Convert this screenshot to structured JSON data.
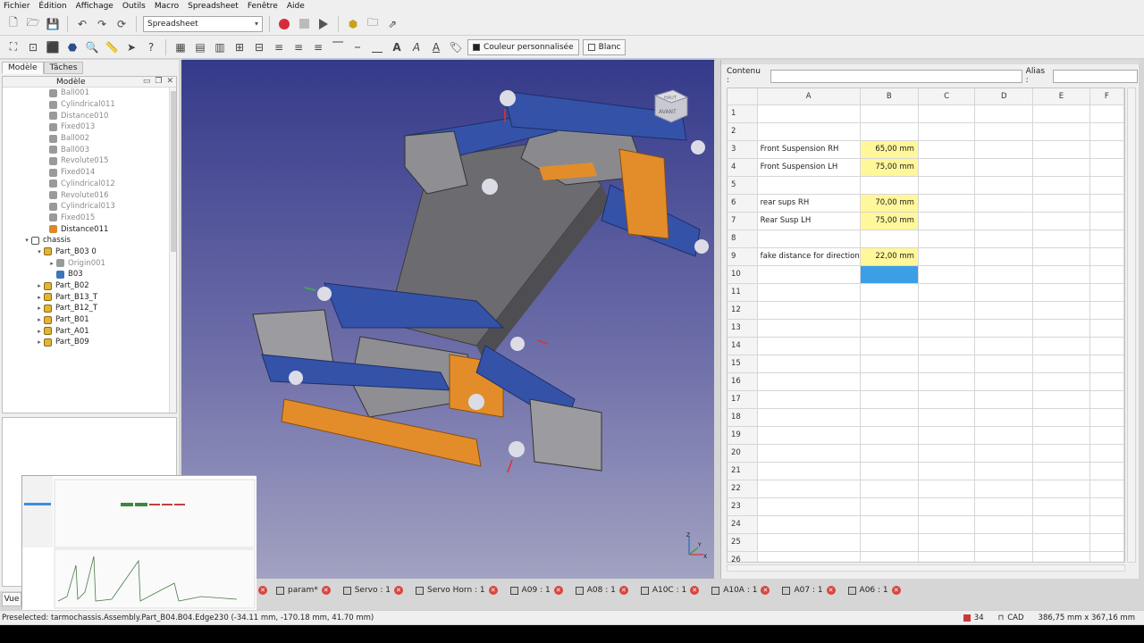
{
  "menu": [
    "Fichier",
    "Édition",
    "Affichage",
    "Outils",
    "Macro",
    "Spreadsheet",
    "Fenêtre",
    "Aide"
  ],
  "toolbar": {
    "workbench": "Spreadsheet",
    "custom_color_label": "Couleur personnalisée",
    "blank_label": "Blanc"
  },
  "left_panel": {
    "tabs": [
      "Modèle",
      "Tâches"
    ],
    "tree_header": "Modèle",
    "tree": [
      {
        "label": "Ball001",
        "dim": true
      },
      {
        "label": "Cylindrical011",
        "dim": true
      },
      {
        "label": "Distance010",
        "dim": true
      },
      {
        "label": "Fixed013",
        "dim": true
      },
      {
        "label": "Ball002",
        "dim": true
      },
      {
        "label": "Ball003",
        "dim": true
      },
      {
        "label": "Revolute015",
        "dim": true
      },
      {
        "label": "Fixed014",
        "dim": true
      },
      {
        "label": "Cylindrical012",
        "dim": true
      },
      {
        "label": "Revolute016",
        "dim": true
      },
      {
        "label": "Cylindrical013",
        "dim": true
      },
      {
        "label": "Fixed015",
        "dim": true
      },
      {
        "label": "Distance011",
        "dim": false
      },
      {
        "label": "chassis",
        "dim": false
      },
      {
        "label": "Part_B03 0",
        "dim": false
      },
      {
        "label": "Origin001",
        "dim": true
      },
      {
        "label": "B03",
        "dim": false
      },
      {
        "label": "Part_B02",
        "dim": false
      },
      {
        "label": "Part_B13_T",
        "dim": false
      },
      {
        "label": "Part_B12_T",
        "dim": false
      },
      {
        "label": "Part_B01",
        "dim": false
      },
      {
        "label": "Part_A01",
        "dim": false
      },
      {
        "label": "Part_B09",
        "dim": false
      }
    ],
    "vue_tab": "Vue"
  },
  "view3d": {
    "navcube_face": "AVANT",
    "navcube_top": "HAUT",
    "axes": [
      "X",
      "Y",
      "Z"
    ]
  },
  "sheet": {
    "contenu_label": "Contenu :",
    "alias_label": "Alias :",
    "columns": [
      "A",
      "B",
      "C",
      "D",
      "E",
      "F"
    ],
    "rows": [
      {
        "n": "1",
        "a": "",
        "b": ""
      },
      {
        "n": "2",
        "a": "",
        "b": ""
      },
      {
        "n": "3",
        "a": "Front Suspension RH",
        "b": "65,00 mm"
      },
      {
        "n": "4",
        "a": "Front Suspension LH",
        "b": "75,00 mm"
      },
      {
        "n": "5",
        "a": "",
        "b": ""
      },
      {
        "n": "6",
        "a": "rear sups RH",
        "b": "70,00 mm"
      },
      {
        "n": "7",
        "a": "Rear Susp LH",
        "b": "75,00 mm"
      },
      {
        "n": "8",
        "a": "",
        "b": ""
      },
      {
        "n": "9",
        "a": "fake distance for direction",
        "b": "22,00 mm"
      },
      {
        "n": "10",
        "a": "",
        "b": "",
        "selected": true
      },
      {
        "n": "11",
        "a": "",
        "b": ""
      },
      {
        "n": "12",
        "a": "",
        "b": ""
      },
      {
        "n": "13",
        "a": "",
        "b": ""
      },
      {
        "n": "14",
        "a": "",
        "b": ""
      },
      {
        "n": "15",
        "a": "",
        "b": ""
      },
      {
        "n": "16",
        "a": "",
        "b": ""
      },
      {
        "n": "17",
        "a": "",
        "b": ""
      },
      {
        "n": "18",
        "a": "",
        "b": ""
      },
      {
        "n": "19",
        "a": "",
        "b": ""
      },
      {
        "n": "20",
        "a": "",
        "b": ""
      },
      {
        "n": "21",
        "a": "",
        "b": ""
      },
      {
        "n": "22",
        "a": "",
        "b": ""
      },
      {
        "n": "23",
        "a": "",
        "b": ""
      },
      {
        "n": "24",
        "a": "",
        "b": ""
      },
      {
        "n": "25",
        "a": "",
        "b": ""
      },
      {
        "n": "26",
        "a": "",
        "b": ""
      }
    ]
  },
  "doc_tabs": [
    "param*",
    "Servo : 1",
    "Servo Horn : 1",
    "A09 : 1",
    "A08 : 1",
    "A10C : 1",
    "A10A : 1",
    "A07 : 1",
    "A06 : 1"
  ],
  "status": {
    "preselected": "Preselected: tarmochassis.Assembly.Part_B04.B04.Edge230 (-34.11 mm, -170.18 mm, 41.70 mm)",
    "count": "34",
    "nav_style": "CAD",
    "dimensions": "386,75 mm x 367,16 mm"
  }
}
